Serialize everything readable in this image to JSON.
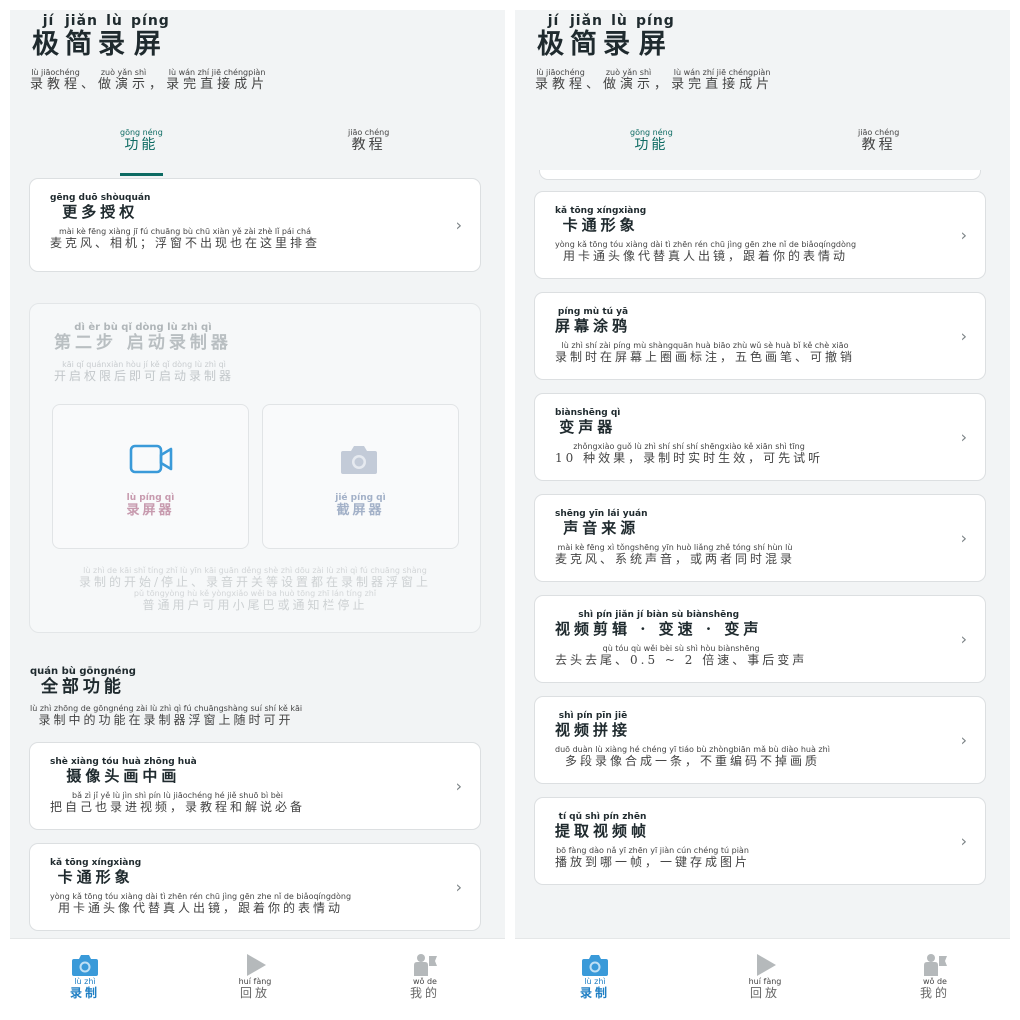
{
  "header": {
    "title": [
      [
        "极",
        "jí"
      ],
      [
        "简",
        "jiǎn"
      ],
      [
        "录",
        "lù"
      ],
      [
        "屏",
        "píng"
      ]
    ],
    "subtitle": [
      [
        "录教程",
        "lù jiāochéng"
      ],
      [
        "、",
        ""
      ],
      [
        "做演示",
        "zuò yǎn shì"
      ],
      [
        "，",
        ""
      ],
      [
        "录完直接成片",
        "lù wán zhí jiē chéngpiàn"
      ]
    ]
  },
  "tabs": [
    {
      "label": "功能",
      "pinyin": "gōng néng",
      "active": true
    },
    {
      "label": "教程",
      "pinyin": "jiāo chéng",
      "active": false
    }
  ],
  "more_permissions": {
    "title": "更多授权",
    "title_pinyin": "gēng duō shòuquán",
    "desc": "麦克风、相机；浮窗不出现也在这里排查",
    "desc_pinyin": "mài kè fēng  xiàng jī   fú chuāng bù chū xiàn yě zài zhè lǐ pái chá"
  },
  "step2": {
    "title": "第二步 启动录制器",
    "title_pinyin": "dì èr bù  qǐ dòng lù zhì qì",
    "desc": "开启权限后即可启动录制器",
    "desc_pinyin": "kāi qǐ quánxiàn hòu jí kě qǐ dòng lù zhì qì",
    "tiles": [
      {
        "label": "录屏器",
        "pinyin": "lù píng qì",
        "color": "#c79aae"
      },
      {
        "label": "截屏器",
        "pinyin": "jié píng qì",
        "color": "#a3b1c8"
      }
    ],
    "note_line1": "录制的开始/停止、录音开关等设置都在录制器浮窗上",
    "note_line1_pinyin": "lù zhì de kāi shǐ tíng zhǐ  lù yīn kāi guān děng shè zhì dōu zài lù zhì qì fú chuāng shàng",
    "note_line2": "普通用户可用小尾巴或通知栏停止",
    "note_line2_pinyin": "pǔ tōngyòng hù kě yòngxiǎo wěi ba huò tōng zhī lán tíng zhǐ"
  },
  "all_features": {
    "title": "全部功能",
    "title_pinyin": "quán bù gōngnéng",
    "desc": "录制中的功能在录制器浮窗上随时可开",
    "desc_pinyin": "lù zhì zhōng de gōngnéng zài lù zhì qì fú chuāngshàng suí shí kě kāi"
  },
  "features": [
    {
      "title": "摄像头画中画",
      "title_pinyin": "shè xiàng tóu huà zhōng huà",
      "desc": "把自己也录进视频，录教程和解说必备",
      "desc_pinyin": "bǎ zì jǐ yě lù jìn shì pín  lù jiāochéng hé jiě shuō bì bèi"
    },
    {
      "title": "卡通形象",
      "title_pinyin": "kǎ tōng xíngxiàng",
      "desc": "用卡通头像代替真人出镜，跟着你的表情动",
      "desc_pinyin": "yòng kǎ tōng tóu xiàng dài tì zhēn rén chū jìng  gēn zhe nǐ de biǎoqíngdòng"
    },
    {
      "title": "屏幕涂鸦",
      "title_pinyin": "píng mù tú yā",
      "desc": "录制时在屏幕上圈画标注，五色画笔、可撤销",
      "desc_pinyin": "lù zhì shí zài píng mù shàngquān huà biāo zhù  wǔ sè huà bǐ  kě chè xiāo"
    },
    {
      "title": "变声器",
      "title_pinyin": "biànshēng qì",
      "desc": "10 种效果，录制时实时生效，可先试听",
      "desc_pinyin": "zhǒngxiào guǒ  lù zhì shí shí shí shēngxiào  kě xiān shì tīng"
    },
    {
      "title": "声音来源",
      "title_pinyin": "shēng yīn lái yuán",
      "desc": "麦克风、系统声音，或两者同时混录",
      "desc_pinyin": "mài kè fēng  xì tǒngshēng yīn  huò liǎng zhě tóng shí hùn lù"
    },
    {
      "title": "视频剪辑 · 变速 · 变声",
      "title_pinyin": "shì pín jiǎn jí  biàn sù  biànshēng",
      "desc": "去头去尾、0.5 ~ 2 倍速、事后变声",
      "desc_pinyin": "qù tóu qù wěi   bèi sù  shì hòu biànshēng"
    },
    {
      "title": "视频拼接",
      "title_pinyin": "shì pín pīn jiē",
      "desc": "多段录像合成一条，不重编码不掉画质",
      "desc_pinyin": "duō duàn lù xiàng hé chéng yī tiáo  bù zhòngbiān mǎ bù diào huà zhì"
    },
    {
      "title": "提取视频帧",
      "title_pinyin": "tí qǔ shì pín zhēn",
      "desc": "播放到哪一帧，一键存成图片",
      "desc_pinyin": "bō fàng dào nǎ yī zhēn  yī jiàn cún chéng tú piàn"
    }
  ],
  "tabbar": [
    {
      "label": "录制",
      "pinyin": "lù zhì",
      "icon": "camera-icon",
      "active": true
    },
    {
      "label": "回放",
      "pinyin": "huí fàng",
      "icon": "play-icon",
      "active": false
    },
    {
      "label": "我的",
      "pinyin": "wǒ de",
      "icon": "user-icon",
      "active": false
    }
  ],
  "colors": {
    "accent": "#0d6b63",
    "tab_active": "#1f7fc4",
    "tile_record": "#3a9ad9"
  }
}
